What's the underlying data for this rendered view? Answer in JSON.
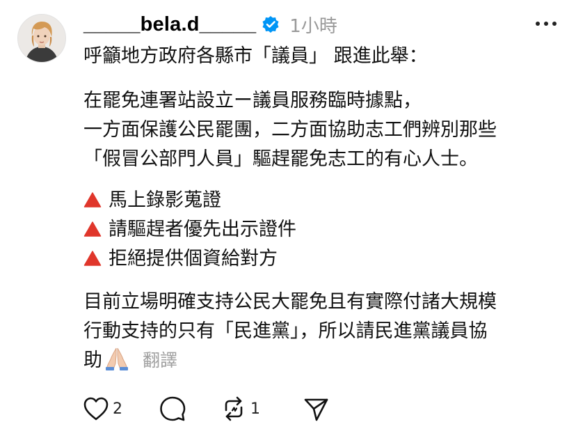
{
  "post": {
    "username": "_____bela.d_____",
    "verified": true,
    "timestamp": "1小時",
    "body": {
      "p1": "呼籲地方政府各縣市「議員」 跟進此舉：",
      "p2": [
        "在罷免連署站設立ー議員服務臨時據點，",
        "一方面保護公民罷團，二方面協助志工們辨別那些",
        "「假冒公部門人員」驅趕罷免志工的有心人士。"
      ],
      "bullets": [
        "馬上錄影蒐證",
        "請驅趕者優先出示證件",
        "拒絕提供個資給對方"
      ],
      "p4": [
        "目前立場明確支持公民大罷免且有實際付諸大規模",
        "行動支持的只有「民進黨」，所以請民進黨議員協",
        "助"
      ],
      "translate_label": "翻譯"
    },
    "actions": {
      "like_count": "2",
      "repost_count": "1"
    },
    "icons": {
      "bullet": "red-triangle-icon",
      "emoji": "folded-hands-emoji",
      "verified": "verified-badge-icon",
      "more": "more-icon",
      "like": "heart-icon",
      "comment": "comment-icon",
      "repost": "repost-icon",
      "share": "share-icon"
    },
    "colors": {
      "verified": "#0095f6",
      "bullet": "#e0362b",
      "muted": "#999999"
    }
  }
}
